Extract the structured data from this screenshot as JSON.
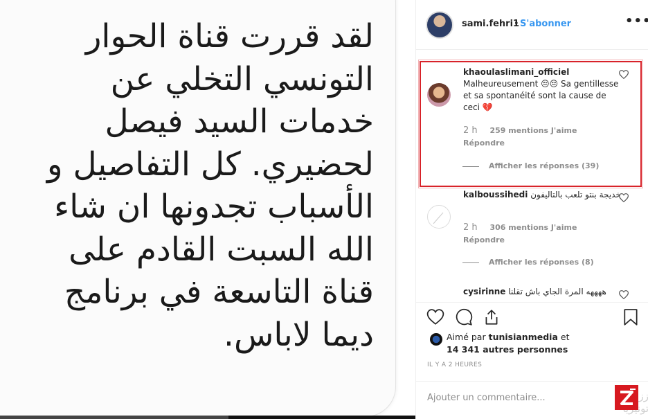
{
  "post_image": {
    "lines": [
      "لقد قررت قناة الحوار",
      "التونسي التخلي عن",
      "خدمات السيد فيصل",
      "لحضيري. كل التفاصيل و",
      "الأسباب تجدونها ان شاء",
      "الله السبت القادم  على",
      "قناة التاسعة في برنامج",
      "ديما لاباس."
    ]
  },
  "header": {
    "username": "sami.fehri1",
    "separator": "•",
    "follow_label": "S'abonner",
    "more_label": "•••"
  },
  "comments": [
    {
      "username": "khaoulaslimani_officiel",
      "text": "Malheureusement 😔😔 Sa gentillesse et sa spontanéité sont la cause de ceci 💔",
      "time": "2 h",
      "likes": "259 mentions J'aime",
      "reply_label": "Répondre",
      "view_replies": "Afficher les réponses (39)"
    },
    {
      "username": "kalboussihedi",
      "text": "خديجة بنتو تلعب بالتاليفون",
      "time": "2 h",
      "likes": "306 mentions J'aime",
      "reply_label": "Répondre",
      "view_replies": "Afficher les réponses (8)"
    },
    {
      "username": "cysirinne",
      "text": "ههههه المرة الجاي باش تقلنا"
    }
  ],
  "likes_summary": {
    "liked_by_label": "Aimé par",
    "liked_by_user": "tunisianmedia",
    "and_label": "et",
    "others": "14 341 autres personnes"
  },
  "timestamp": "IL Y A 2 HEURES",
  "add_comment": {
    "placeholder": "Ajouter un commentaire..."
  },
  "watermark": "ززوم تونيزيا",
  "colors": {
    "link_blue": "#3897f0",
    "highlight_red": "#d8232a",
    "muted_gray": "#8e8e8e",
    "text_dark": "#262626"
  }
}
